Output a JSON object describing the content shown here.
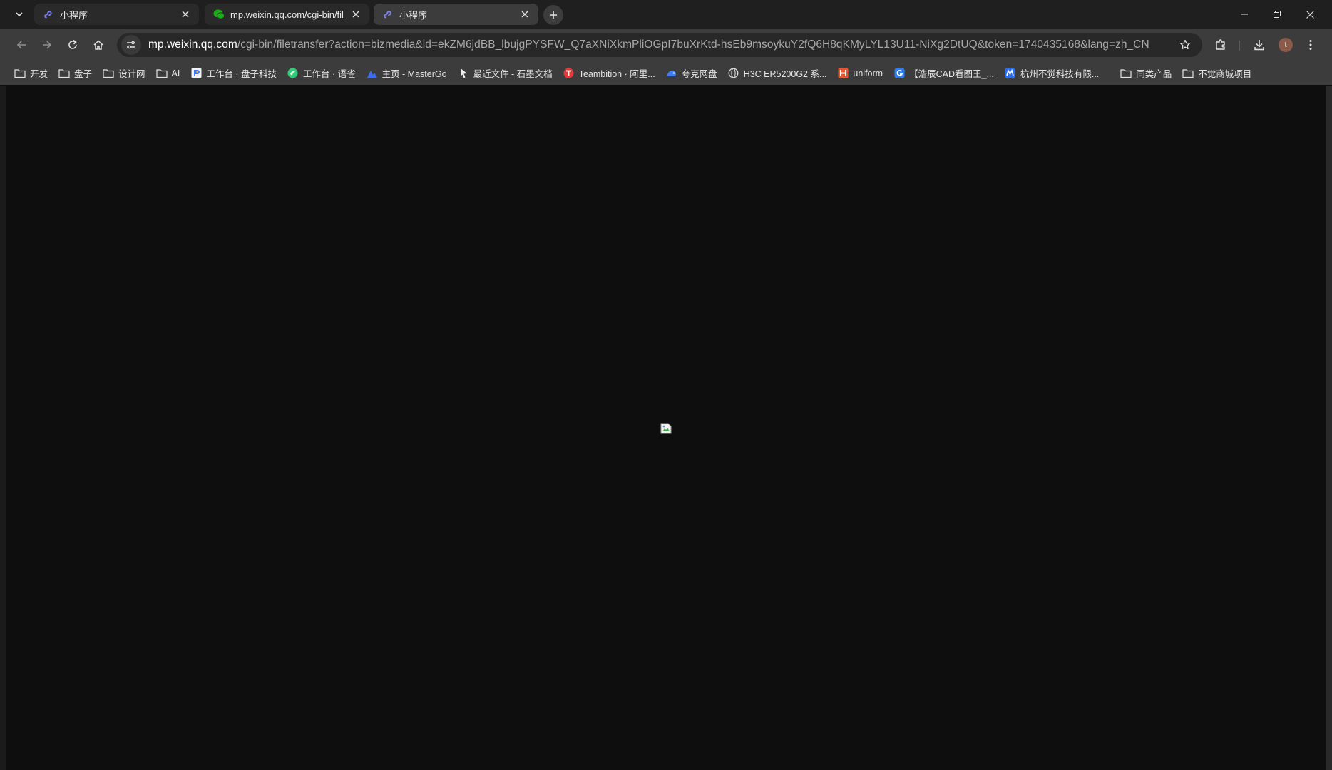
{
  "browser": {
    "tabs": [
      {
        "title": "小程序",
        "favicon": "miniprogram-icon",
        "active": false
      },
      {
        "title": "mp.weixin.qq.com/cgi-bin/fil",
        "favicon": "wechat-icon",
        "active": false
      },
      {
        "title": "小程序",
        "favicon": "miniprogram-icon",
        "active": true
      }
    ],
    "address": {
      "host": "mp.weixin.qq.com",
      "path": "/cgi-bin/filetransfer?action=bizmedia&id=ekZM6jdBB_lbujgPYSFW_Q7aXNiXkmPliOGpI7buXrKtd-hsEb9msoykuY2fQ6H8qKMyLYL13U11-NiXg2DtUQ&token=1740435168&lang=zh_CN"
    },
    "profile_initial": "t",
    "bookmarks": [
      {
        "label": "开发",
        "icon": "folder-icon"
      },
      {
        "label": "盘子",
        "icon": "folder-icon"
      },
      {
        "label": "设计网",
        "icon": "folder-icon"
      },
      {
        "label": "AI",
        "icon": "folder-icon"
      },
      {
        "label": "工作台 · 盘子科技",
        "icon": "workbench-icon"
      },
      {
        "label": "工作台 · 语雀",
        "icon": "yuque-icon"
      },
      {
        "label": "主页 - MasterGo",
        "icon": "mastergo-icon"
      },
      {
        "label": "最近文件 - 石墨文档",
        "icon": "shimo-icon"
      },
      {
        "label": "Teambition · 阿里...",
        "icon": "teambition-icon"
      },
      {
        "label": "夸克网盘",
        "icon": "quark-icon"
      },
      {
        "label": "H3C ER5200G2 系...",
        "icon": "globe-icon"
      },
      {
        "label": "uniform",
        "icon": "uniform-icon"
      },
      {
        "label": "【浩辰CAD看图王_...",
        "icon": "gstarcad-icon"
      },
      {
        "label": "杭州不觉科技有限...",
        "icon": "buju-icon"
      },
      {
        "label": "同类产品",
        "icon": "folder-icon"
      },
      {
        "label": "不觉商城项目",
        "icon": "folder-icon"
      }
    ]
  },
  "colors": {
    "tabstrip": "#1f1f1f",
    "toolbar": "#3c3c3c",
    "page_bg": "#0e0e0e",
    "wechat_green": "#1aad19",
    "miniprogram_blue": "#6b6ff0"
  }
}
